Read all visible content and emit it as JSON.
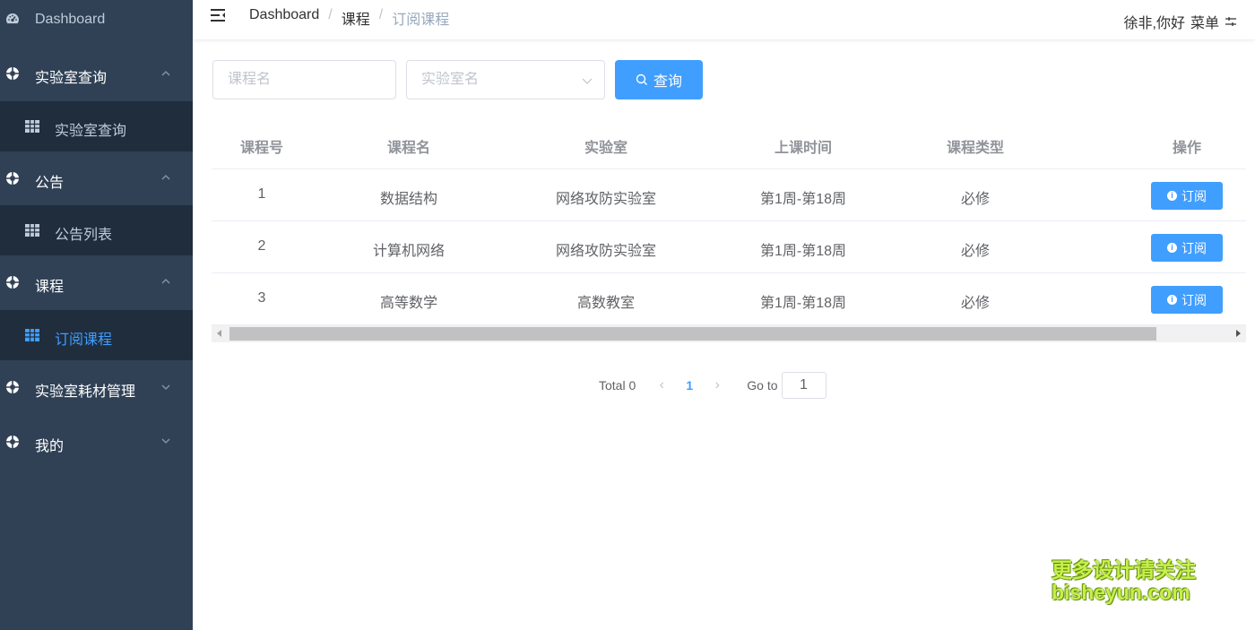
{
  "sidebar": {
    "items": [
      {
        "label": "Dashboard",
        "icon": "dashboard-icon"
      },
      {
        "label": "实验室查询",
        "icon": "lifebuoy-icon",
        "expanded": true
      },
      {
        "label": "实验室查询",
        "icon": "table-icon",
        "sub": true
      },
      {
        "label": "公告",
        "icon": "lifebuoy-icon",
        "expanded": true
      },
      {
        "label": "公告列表",
        "icon": "table-icon",
        "sub": true
      },
      {
        "label": "课程",
        "icon": "lifebuoy-icon",
        "expanded": true
      },
      {
        "label": "订阅课程",
        "icon": "table-icon",
        "sub": true,
        "active": true
      },
      {
        "label": "实验室耗材管理",
        "icon": "lifebuoy-icon",
        "expanded": false
      },
      {
        "label": "我的",
        "icon": "lifebuoy-icon",
        "expanded": false
      }
    ]
  },
  "header": {
    "breadcrumb": [
      "Dashboard",
      "课程",
      "订阅课程"
    ],
    "separator": "/",
    "greeting": "徐非,你好",
    "menu_label": "菜单"
  },
  "filters": {
    "course_placeholder": "课程名",
    "lab_placeholder": "实验室名",
    "query_label": "查询"
  },
  "table": {
    "columns": [
      "课程号",
      "课程名",
      "实验室",
      "上课时间",
      "课程类型",
      "操作"
    ],
    "rows": [
      {
        "id": "1",
        "name": "数据结构",
        "lab": "网络攻防实验室",
        "time": "第1周-第18周",
        "type": "必修",
        "action": "订阅"
      },
      {
        "id": "2",
        "name": "计算机网络",
        "lab": "网络攻防实验室",
        "time": "第1周-第18周",
        "type": "必修",
        "action": "订阅"
      },
      {
        "id": "3",
        "name": "高等数学",
        "lab": "高数教室",
        "time": "第1周-第18周",
        "type": "必修",
        "action": "订阅"
      }
    ]
  },
  "pagination": {
    "total_label": "Total 0",
    "current_page": "1",
    "goto_label": "Go to",
    "goto_value": "1"
  },
  "watermark": {
    "line1": "更多设计请关注",
    "line2": "bisheyun.com"
  },
  "colors": {
    "sidebar_bg": "#304156",
    "submenu_bg": "#1f2d3d",
    "primary": "#409eff"
  }
}
